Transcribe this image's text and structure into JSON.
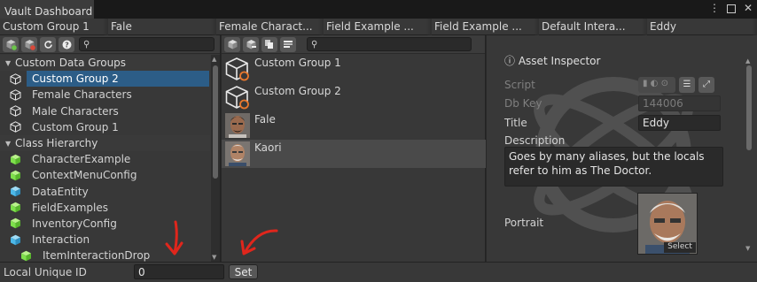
{
  "window": {
    "title": "Vault Dashboard",
    "menu_glyph": "⋮",
    "max_glyph": "",
    "close_glyph": "✕"
  },
  "breadcrumb": [
    {
      "label": "Custom Group 1"
    },
    {
      "label": "Fale"
    },
    {
      "label": "Female Charact..."
    },
    {
      "label": "Field Example ..."
    },
    {
      "label": "Field Example ..."
    },
    {
      "label": "Default Intera..."
    },
    {
      "label": "Eddy"
    }
  ],
  "left_panel": {
    "toolbar_icons": [
      "add-group-icon",
      "remove-group-icon",
      "refresh-icon",
      "help-icon"
    ],
    "search": {
      "value": "",
      "placeholder": ""
    },
    "search_glyph": "⚲",
    "sections": [
      {
        "title": "Custom Data Groups",
        "items": [
          {
            "label": "Custom Group 2",
            "selected": true
          },
          {
            "label": "Female Characters"
          },
          {
            "label": "Male Characters"
          },
          {
            "label": "Custom Group 1"
          }
        ]
      },
      {
        "title": "Class Hierarchy",
        "items": [
          {
            "label": "CharacterExample",
            "color": "#7ee04c"
          },
          {
            "label": "ContextMenuConfig",
            "color": "#7ee04c"
          },
          {
            "label": "DataEntity",
            "color": "#4db8e8"
          },
          {
            "label": "FieldExamples",
            "color": "#7ee04c"
          },
          {
            "label": "InventoryConfig",
            "color": "#7ee04c"
          },
          {
            "label": "Interaction",
            "color": "#4db8e8"
          },
          {
            "label": "ItemInteractionDrop",
            "color": "#7ee04c"
          }
        ]
      }
    ]
  },
  "mid_panel": {
    "toolbar_icons": [
      "add-asset-icon",
      "remove-asset-icon",
      "duplicate-icon",
      "group-icon"
    ],
    "search": {
      "value": "",
      "placeholder": ""
    },
    "search_glyph": "⚲",
    "items": [
      {
        "label": "Custom Group 1",
        "kind": "group"
      },
      {
        "label": "Custom Group 2",
        "kind": "group"
      },
      {
        "label": "Fale",
        "kind": "portrait"
      },
      {
        "label": "Kaori",
        "kind": "portrait",
        "selected": true
      }
    ]
  },
  "inspector": {
    "header": "Asset Inspector",
    "info_glyph": "ⓘ",
    "fields": {
      "script_label": "Script",
      "dbkey_label": "Db Key",
      "dbkey_value": "144006",
      "title_label": "Title",
      "title_value": "Eddy",
      "description_label": "Description",
      "description_value": "Goes by many aliases, but the locals refer to him as The Doctor.",
      "portrait_label": "Portrait",
      "portrait_select": "Select"
    }
  },
  "bottom": {
    "label": "Local Unique ID",
    "value": "0",
    "button": "Set"
  },
  "colors": {
    "selection": "#2c5d87",
    "annotation": "#e0261c"
  }
}
